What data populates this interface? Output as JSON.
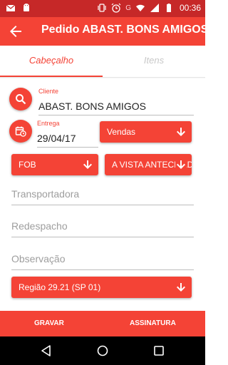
{
  "status_bar": {
    "time": "00:36",
    "left_icons": [
      "mail-icon",
      "android-icon"
    ],
    "right_icons": [
      "vibrate-icon",
      "alarm-icon",
      "wifi-icon",
      "signal-icon",
      "battery-icon"
    ],
    "network_letter": "G"
  },
  "app_bar": {
    "title": "Pedido ABAST. BONS AMIGOS"
  },
  "tabs": [
    {
      "label": "Cabeçalho",
      "active": true
    },
    {
      "label": "Itens",
      "active": false
    }
  ],
  "cliente": {
    "label": "Cliente",
    "value": "ABAST. BONS AMIGOS",
    "icon": "search-icon"
  },
  "entrega": {
    "label": "Entrega",
    "value": "29/04/17",
    "icon": "calendar-clock-icon"
  },
  "dropdowns": {
    "tipo": "Vendas",
    "frete": "FOB",
    "pagamento": "A VISTA ANTECIPADO",
    "regiao": "Região 29.21 (SP 01)"
  },
  "fields": {
    "transportadora": "Transportadora",
    "redespacho": "Redespacho",
    "observacao": "Observação"
  },
  "actions": {
    "gravar": "GRAVAR",
    "assinatura": "ASSINATURA"
  },
  "colors": {
    "primary": "#f44336",
    "primary_dark": "#c62828",
    "hint": "#9e9e9e"
  }
}
